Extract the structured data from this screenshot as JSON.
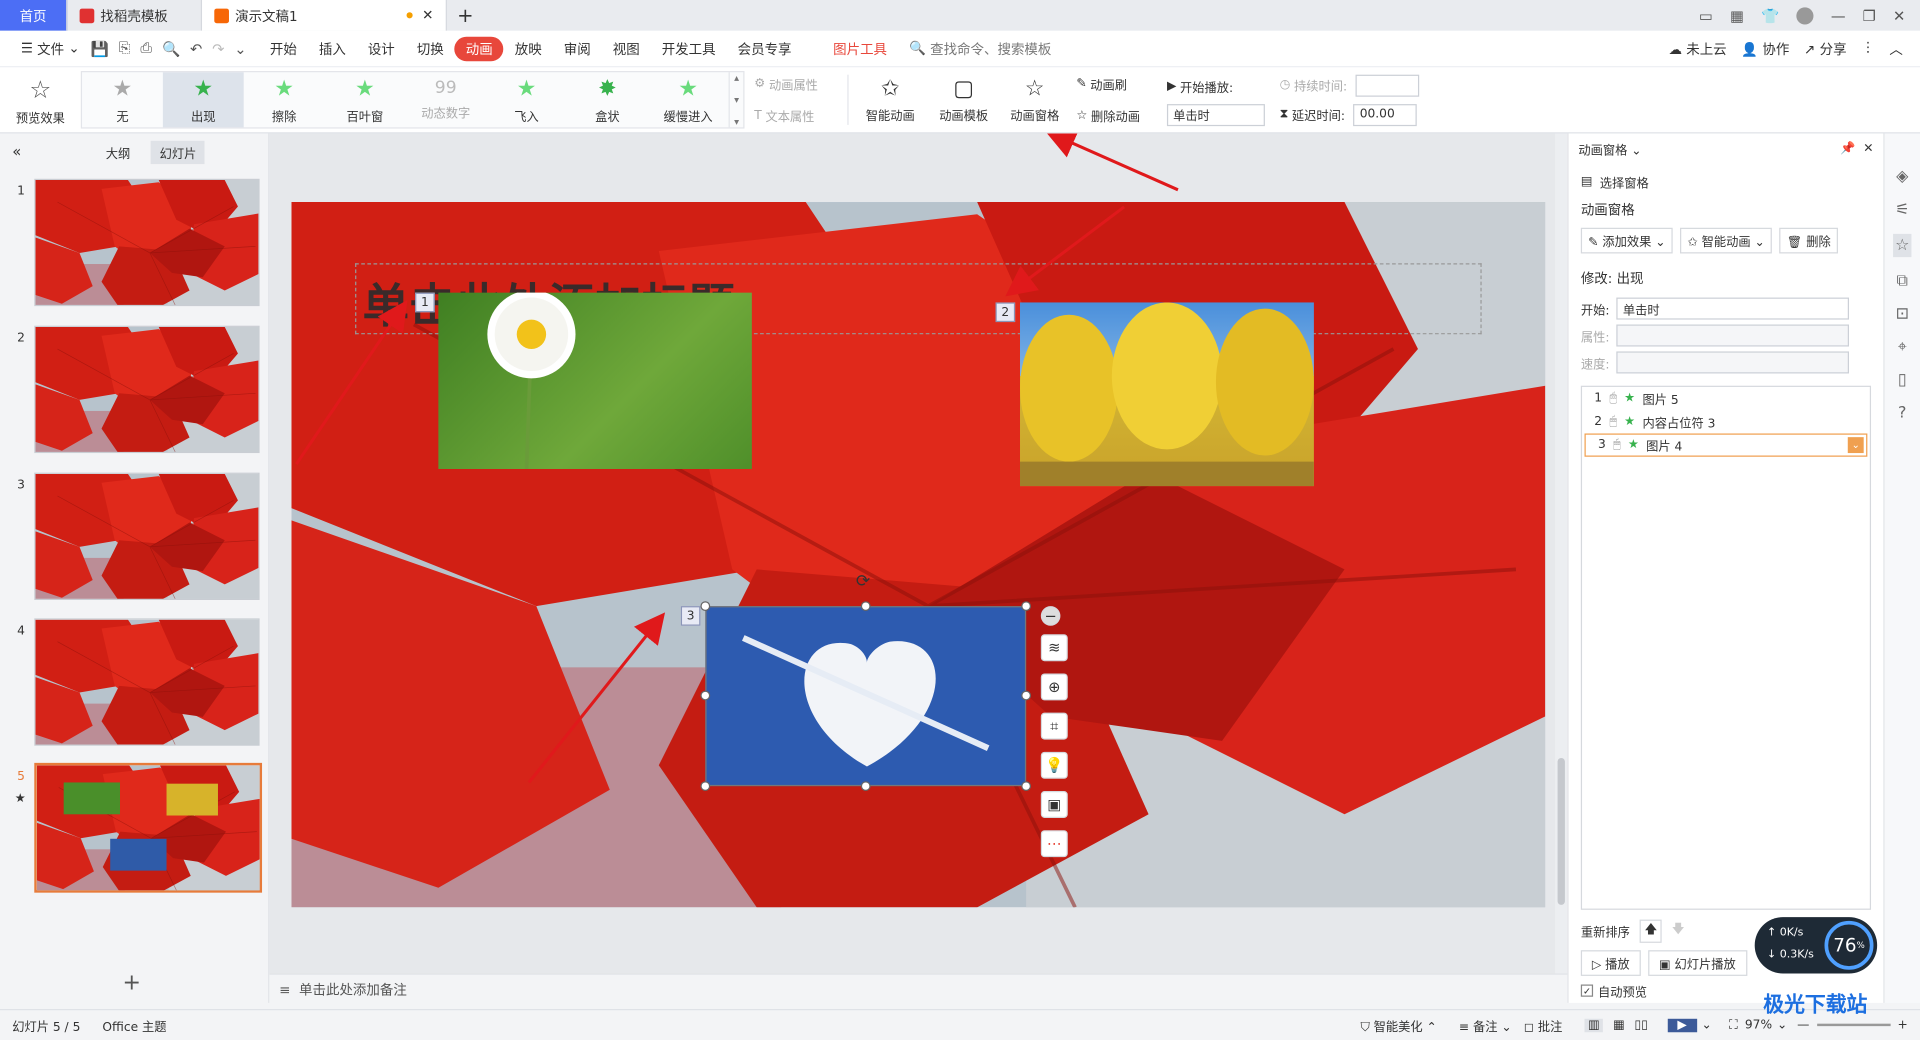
{
  "tabs": {
    "home": "首页",
    "template": "找稻壳模板",
    "doc": "演示文稿1"
  },
  "menu": {
    "file": "文件",
    "items": [
      "开始",
      "插入",
      "设计",
      "切换",
      "动画",
      "放映",
      "审阅",
      "视图",
      "开发工具",
      "会员专享"
    ],
    "picture_tools": "图片工具",
    "search": "查找命令、搜索模板",
    "cloud": "未上云",
    "collab": "协作",
    "share": "分享"
  },
  "ribbon": {
    "preview": "预览效果",
    "effects": [
      "无",
      "出现",
      "擦除",
      "百叶窗",
      "动态数字",
      "飞入",
      "盒状",
      "缓慢进入"
    ],
    "anim_props": "动画属性",
    "text_props": "文本属性",
    "smart_anim": "智能动画",
    "anim_template": "动画模板",
    "anim_pane": "动画窗格",
    "anim_brush": "动画刷",
    "delete_anim": "删除动画",
    "start_play": "开始播放:",
    "start_value": "单击时",
    "duration": "持续时间:",
    "delay": "延迟时间:",
    "delay_value": "00.00"
  },
  "thumbs": {
    "outline": "大纲",
    "slides": "幻灯片",
    "numbers": [
      "1",
      "2",
      "3",
      "4",
      "5"
    ]
  },
  "slide": {
    "title_placeholder": "单击此处添加标题",
    "badges": [
      "1",
      "2",
      "3"
    ]
  },
  "notes": "单击此处添加备注",
  "pane": {
    "title": "动画窗格",
    "select_pane": "选择窗格",
    "section": "动画窗格",
    "add_effect": "添加效果",
    "smart_anim": "智能动画",
    "delete": "删除",
    "modify": "修改: 出现",
    "start_label": "开始:",
    "start_value": "单击时",
    "prop_label": "属性:",
    "speed_label": "速度:",
    "items": [
      {
        "num": "1",
        "name": "图片 5"
      },
      {
        "num": "2",
        "name": "内容占位符 3"
      },
      {
        "num": "3",
        "name": "图片 4"
      }
    ],
    "reorder": "重新排序",
    "play": "播放",
    "slideshow": "幻灯片播放",
    "autopreview": "自动预览"
  },
  "status": {
    "slide": "幻灯片 5 / 5",
    "theme": "Office 主题",
    "beautify": "智能美化",
    "notes": "备注",
    "comments": "批注",
    "zoom": "97%"
  },
  "widget": {
    "up": "0K/s",
    "down": "0.3K/s",
    "pct": "76"
  },
  "watermark": "极光下载站"
}
